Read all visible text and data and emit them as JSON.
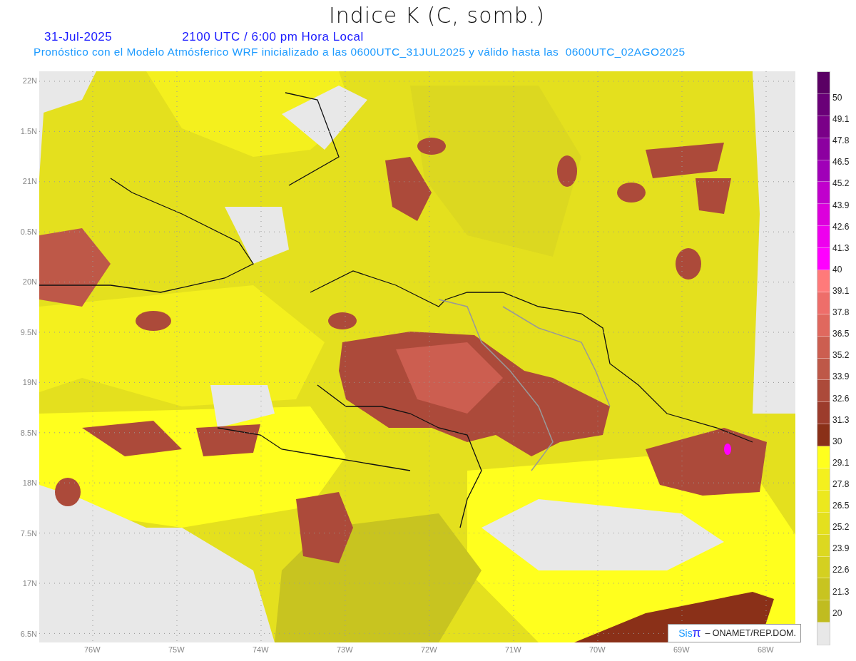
{
  "title": "Indice K (C, somb.)",
  "date": "31-Jul-2025",
  "time": "2100 UTC / 6:00 pm Hora Local",
  "subtitle": "Pronóstico con el Modelo Atmósferico WRF inicializado a las 0600UTC_31JUL2025 y válido hasta las  0600UTC_02AGO2025",
  "map": {
    "lat_labels": [
      "22N",
      "1.5N",
      "21N",
      "0.5N",
      "20N",
      "9.5N",
      "19N",
      "8.5N",
      "18N",
      "7.5N",
      "17N",
      "6.5N"
    ],
    "lon_labels": [
      "76W",
      "75W",
      "74W",
      "73W",
      "72W",
      "71W",
      "70W",
      "69W",
      "68W"
    ]
  },
  "colorbar": [
    {
      "label": "50",
      "color": "#5a0064"
    },
    {
      "label": "49.1",
      "color": "#6a0078"
    },
    {
      "label": "47.8",
      "color": "#7a0088"
    },
    {
      "label": "46.5",
      "color": "#8c00a0"
    },
    {
      "label": "45.2",
      "color": "#a000b8"
    },
    {
      "label": "43.9",
      "color": "#c000cc"
    },
    {
      "label": "42.6",
      "color": "#dc00dc"
    },
    {
      "label": "41.3",
      "color": "#ee00ee"
    },
    {
      "label": "40",
      "color": "#ff00ff"
    },
    {
      "label": "39.1",
      "color": "#ff7a7a"
    },
    {
      "label": "37.8",
      "color": "#ee6e6a"
    },
    {
      "label": "36.5",
      "color": "#e0685e"
    },
    {
      "label": "35.2",
      "color": "#cc5e50"
    },
    {
      "label": "33.9",
      "color": "#be5848"
    },
    {
      "label": "32.6",
      "color": "#ac4a3a"
    },
    {
      "label": "31.3",
      "color": "#9c3c2c"
    },
    {
      "label": "30",
      "color": "#8a3018"
    },
    {
      "label": "29.1",
      "color": "#ffff1e"
    },
    {
      "label": "27.8",
      "color": "#f4f01e"
    },
    {
      "label": "26.5",
      "color": "#ece81e"
    },
    {
      "label": "25.2",
      "color": "#e4e01e"
    },
    {
      "label": "23.9",
      "color": "#dcd820"
    },
    {
      "label": "22.6",
      "color": "#d4d020"
    },
    {
      "label": "21.3",
      "color": "#c8c420"
    },
    {
      "label": "20",
      "color": "#c0bc20"
    },
    {
      "color": "#e8e8e8"
    }
  ],
  "credit": {
    "logo_letters": "Sis",
    "logo_symbol": "π",
    "text": "– ONAMET/REP.DOM."
  }
}
